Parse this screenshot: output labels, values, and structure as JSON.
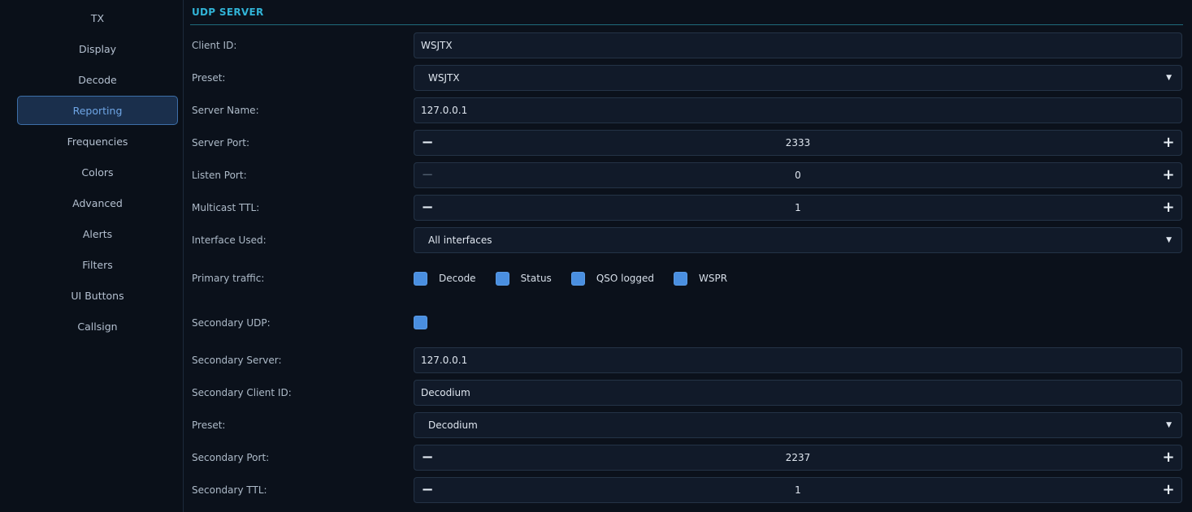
{
  "sidebar": {
    "items": [
      {
        "label": "TX",
        "active": false
      },
      {
        "label": "Display",
        "active": false
      },
      {
        "label": "Decode",
        "active": false
      },
      {
        "label": "Reporting",
        "active": true
      },
      {
        "label": "Frequencies",
        "active": false
      },
      {
        "label": "Colors",
        "active": false
      },
      {
        "label": "Advanced",
        "active": false
      },
      {
        "label": "Alerts",
        "active": false
      },
      {
        "label": "Filters",
        "active": false
      },
      {
        "label": "UI Buttons",
        "active": false
      },
      {
        "label": "Callsign",
        "active": false
      }
    ]
  },
  "section": {
    "title": "UDP SERVER"
  },
  "form": {
    "client_id": {
      "label": "Client ID:",
      "value": "WSJTX"
    },
    "preset": {
      "label": "Preset:",
      "value": "WSJTX"
    },
    "server_name": {
      "label": "Server Name:",
      "value": "127.0.0.1"
    },
    "server_port": {
      "label": "Server Port:",
      "value": "2333"
    },
    "listen_port": {
      "label": "Listen Port:",
      "value": "0"
    },
    "multicast_ttl": {
      "label": "Multicast TTL:",
      "value": "1"
    },
    "interface_used": {
      "label": "Interface Used:",
      "value": "All interfaces"
    },
    "primary_traffic": {
      "label": "Primary traffic:",
      "options": [
        {
          "label": "Decode",
          "checked": true
        },
        {
          "label": "Status",
          "checked": true
        },
        {
          "label": "QSO logged",
          "checked": true
        },
        {
          "label": "WSPR",
          "checked": true
        }
      ]
    },
    "secondary_udp": {
      "label": "Secondary UDP:",
      "checked": true
    },
    "secondary_server": {
      "label": "Secondary Server:",
      "value": "127.0.0.1"
    },
    "secondary_client_id": {
      "label": "Secondary Client ID:",
      "value": "Decodium"
    },
    "secondary_preset": {
      "label": "Preset:",
      "value": "Decodium"
    },
    "secondary_port": {
      "label": "Secondary Port:",
      "value": "2237"
    },
    "secondary_ttl": {
      "label": "Secondary TTL:",
      "value": "1"
    }
  },
  "icons": {
    "minus": "−",
    "plus": "+",
    "caret": "▼"
  },
  "colors": {
    "accent": "#31b3d6",
    "active_nav": "#6fa6e6",
    "checkbox": "#4a8fe0"
  }
}
